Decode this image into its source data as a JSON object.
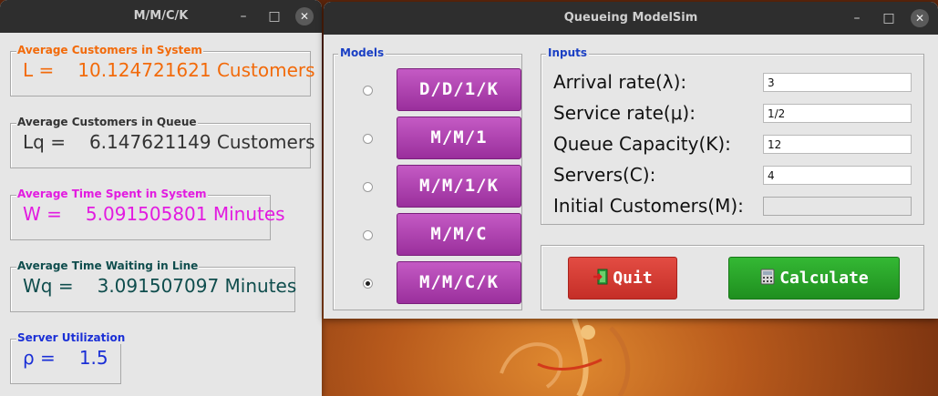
{
  "results_window": {
    "title": "M/M/C/K",
    "results": [
      {
        "legend": "Average Customers in System",
        "symbol": "L =",
        "value": "10.124721621 Customers",
        "color": "#f26a0a"
      },
      {
        "legend": "Average Customers in Queue",
        "symbol": "Lq =",
        "value": "6.147621149 Customers",
        "color": "#333333"
      },
      {
        "legend": "Average Time Spent in System",
        "symbol": "W =",
        "value": "5.091505801 Minutes",
        "color": "#e21be0"
      },
      {
        "legend": "Average Time Waiting in Line",
        "symbol": "Wq =",
        "value": "3.091507097 Minutes",
        "color": "#0f4d4d"
      },
      {
        "legend": "Server Utilization",
        "symbol": "ρ =",
        "value": "1.5",
        "color": "#1a2fd6"
      }
    ]
  },
  "main_window": {
    "title": "Queueing ModelSim",
    "models": {
      "legend": "Models",
      "items": [
        {
          "label": "D/D/1/K",
          "selected": false
        },
        {
          "label": "M/M/1",
          "selected": false
        },
        {
          "label": "M/M/1/K",
          "selected": false
        },
        {
          "label": "M/M/C",
          "selected": false
        },
        {
          "label": "M/M/C/K",
          "selected": true
        }
      ]
    },
    "inputs": {
      "legend": "Inputs",
      "fields": [
        {
          "label": "Arrival rate(λ):",
          "value": "3"
        },
        {
          "label": "Service rate(μ):",
          "value": "1/2"
        },
        {
          "label": "Queue Capacity(K):",
          "value": "12"
        },
        {
          "label": "Servers(C):",
          "value": "4"
        },
        {
          "label": "Initial Customers(M):",
          "value": ""
        }
      ]
    },
    "actions": {
      "quit_label": "Quit",
      "calculate_label": "Calculate",
      "quit_color": "#d93a32",
      "calculate_color": "#2aa52a"
    }
  },
  "window_controls": {
    "minimize": "–",
    "maximize": "□",
    "close": "✕"
  }
}
